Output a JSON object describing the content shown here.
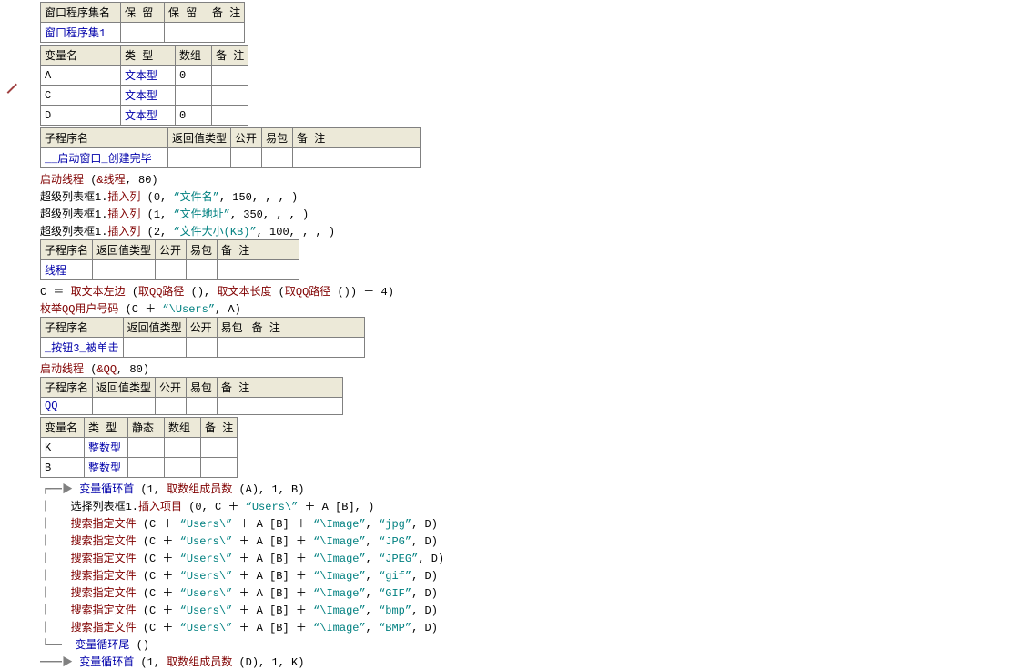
{
  "tables": {
    "t1": {
      "headers": [
        "窗口程序集名",
        "保 留",
        "保 留",
        "备 注"
      ],
      "rows": [
        [
          "窗口程序集1",
          "",
          "",
          ""
        ]
      ]
    },
    "t2": {
      "headers": [
        "变量名",
        "类 型",
        "数组",
        "备 注"
      ],
      "rows": [
        [
          "A",
          "文本型",
          "0",
          ""
        ],
        [
          "C",
          "文本型",
          "",
          ""
        ],
        [
          "D",
          "文本型",
          "0",
          ""
        ]
      ]
    },
    "t3": {
      "headers": [
        "子程序名",
        "返回值类型",
        "公开",
        "易包",
        "备 注"
      ],
      "rows": [
        [
          "__启动窗口_创建完毕",
          "",
          "",
          "",
          ""
        ]
      ]
    },
    "t4": {
      "headers": [
        "子程序名",
        "返回值类型",
        "公开",
        "易包",
        "备 注"
      ],
      "rows": [
        [
          "线程",
          "",
          "",
          "",
          ""
        ]
      ]
    },
    "t5": {
      "headers": [
        "子程序名",
        "返回值类型",
        "公开",
        "易包",
        "备 注"
      ],
      "rows": [
        [
          "_按钮3_被单击",
          "",
          "",
          "",
          ""
        ]
      ]
    },
    "t6": {
      "headers": [
        "子程序名",
        "返回值类型",
        "公开",
        "易包",
        "备 注"
      ],
      "rows": [
        [
          "QQ",
          "",
          "",
          "",
          ""
        ]
      ]
    },
    "t7": {
      "headers": [
        "变量名",
        "类 型",
        "静态",
        "数组",
        "备 注"
      ],
      "rows": [
        [
          "K",
          "整数型",
          "",
          "",
          ""
        ],
        [
          "B",
          "整数型",
          "",
          "",
          ""
        ]
      ]
    }
  },
  "code": {
    "l1a": "启动线程",
    "l1b": " (",
    "l1c": "&线程",
    "l1d": ", 80)",
    "l2a": "超级列表框1.",
    "l2b": "插入列",
    "l2c": " (0, ",
    "l2d": "“文件名”",
    "l2e": ", 150, , , )",
    "l3a": "超级列表框1.",
    "l3b": "插入列",
    "l3c": " (1, ",
    "l3d": "“文件地址”",
    "l3e": ", 350, , , )",
    "l4a": "超级列表框1.",
    "l4b": "插入列",
    "l4c": " (2, ",
    "l4d": "“文件大小(KB)”",
    "l4e": ", 100, , , )",
    "l5a": "C ＝ ",
    "l5b": "取文本左边",
    "l5c": " (",
    "l5d": "取QQ路径",
    "l5e": " (), ",
    "l5f": "取文本长度",
    "l5g": " (",
    "l5h": "取QQ路径",
    "l5i": " ()) － 4)",
    "l6a": "枚举QQ用户号码",
    "l6b": " (C ＋ ",
    "l6c": "“\\Users”",
    "l6d": ", A)",
    "l7a": "启动线程",
    "l7b": " (",
    "l7c": "&QQ",
    "l7d": ", 80)",
    "l8m": "┏━▶ ",
    "l8a": "变量循环首",
    "l8b": " (1, ",
    "l8c": "取数组成员数",
    "l8d": " (A), 1, B)",
    "l9m": "┃   ",
    "l9a": "选择列表框1.",
    "l9b": "插入项目",
    "l9c": " (0, C ＋ ",
    "l9d": "“Users\\”",
    "l9e": " ＋ A [B], )",
    "l10m": "┃   ",
    "l10a": "搜索指定文件",
    "l10b": " (C ＋ ",
    "l10c": "“Users\\”",
    "l10d": " ＋ A [B] ＋ ",
    "l10e": "“\\Image”",
    "l10f": ", ",
    "l10g": "“jpg”",
    "l10h": ", D)",
    "l11g": "“JPG”",
    "l12g": "“JPEG”",
    "l13g": "“gif”",
    "l14g": "“GIF”",
    "l15g": "“bmp”",
    "l16g": "“BMP”",
    "l17m": "┗━  ",
    "l17a": "变量循环尾",
    "l17b": " ()",
    "l18m": "━━▶ ",
    "l18a": "变量循环首",
    "l18b": " (1, ",
    "l18c": "取数组成员数",
    "l18d": " (D), 1, K)"
  },
  "widths": {
    "t1": [
      88,
      48,
      48,
      40
    ],
    "t2": [
      88,
      60,
      40,
      40
    ],
    "t3": [
      140,
      62,
      34,
      34,
      140
    ],
    "t4": [
      56,
      62,
      34,
      34,
      138
    ],
    "t5": [
      90,
      62,
      34,
      34,
      128
    ],
    "t6": [
      56,
      62,
      34,
      34,
      138
    ],
    "t7": [
      48,
      48,
      40,
      40,
      40
    ]
  }
}
